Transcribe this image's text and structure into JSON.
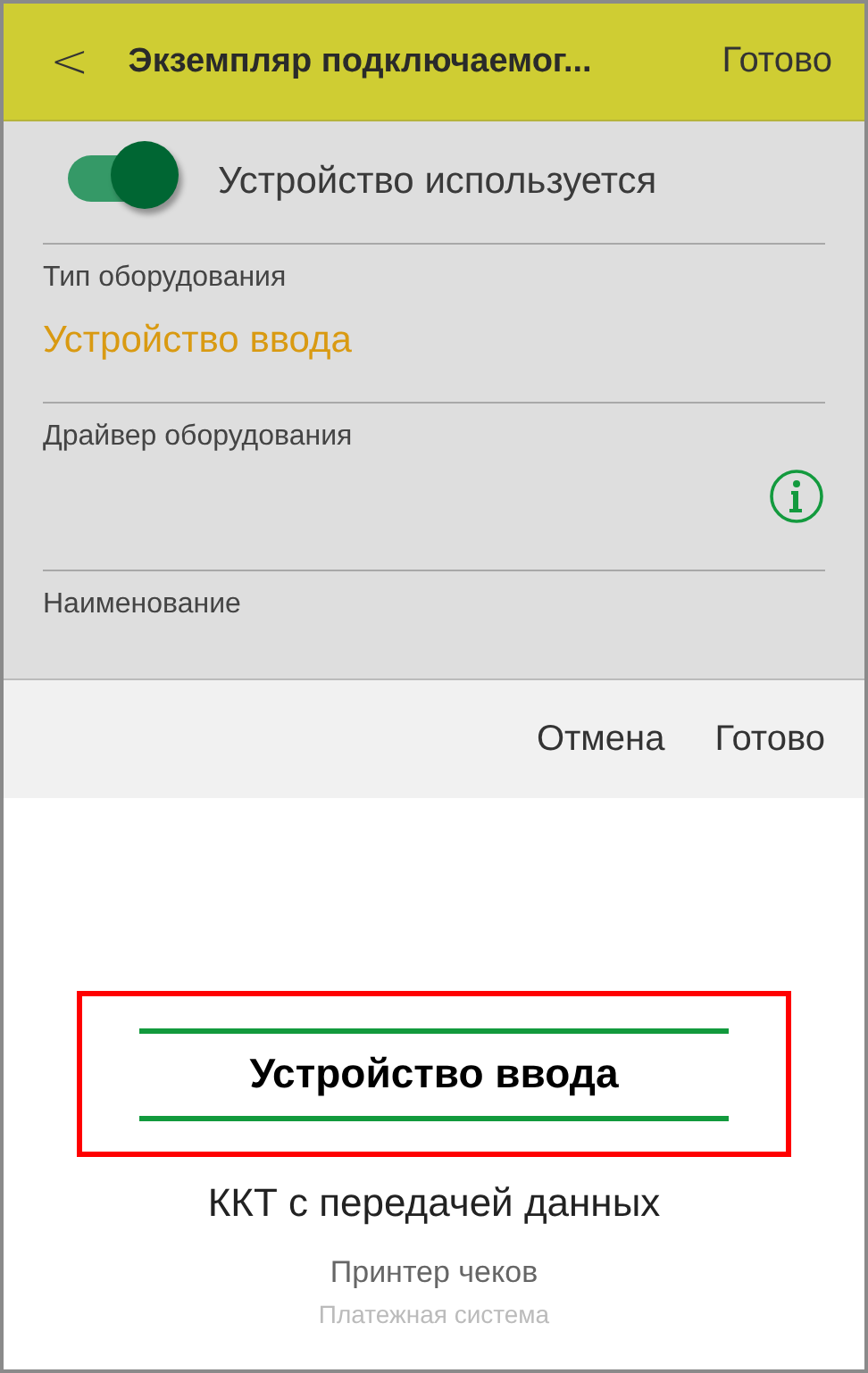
{
  "header": {
    "back": "<",
    "title": "Экземпляр подключаемог...",
    "done": "Готово"
  },
  "switch": {
    "on": true,
    "label": "Устройство используется"
  },
  "fields": [
    {
      "kind": "value",
      "label": "Тип оборудования",
      "value": "Устройство ввода"
    },
    {
      "kind": "info",
      "label": "Драйвер оборудования"
    },
    {
      "kind": "plain",
      "label": "Наименование"
    }
  ],
  "picker_bar": {
    "buttons": [
      "Отмена",
      "Готово"
    ]
  },
  "picker": {
    "options": [
      {
        "label": "Устройство ввода",
        "selected": true
      },
      {
        "label": "ККТ с передачей данных",
        "selected": false
      },
      {
        "label": "Принтер чеков",
        "selected": false
      },
      {
        "label": "Платежная система",
        "selected": false
      }
    ]
  }
}
